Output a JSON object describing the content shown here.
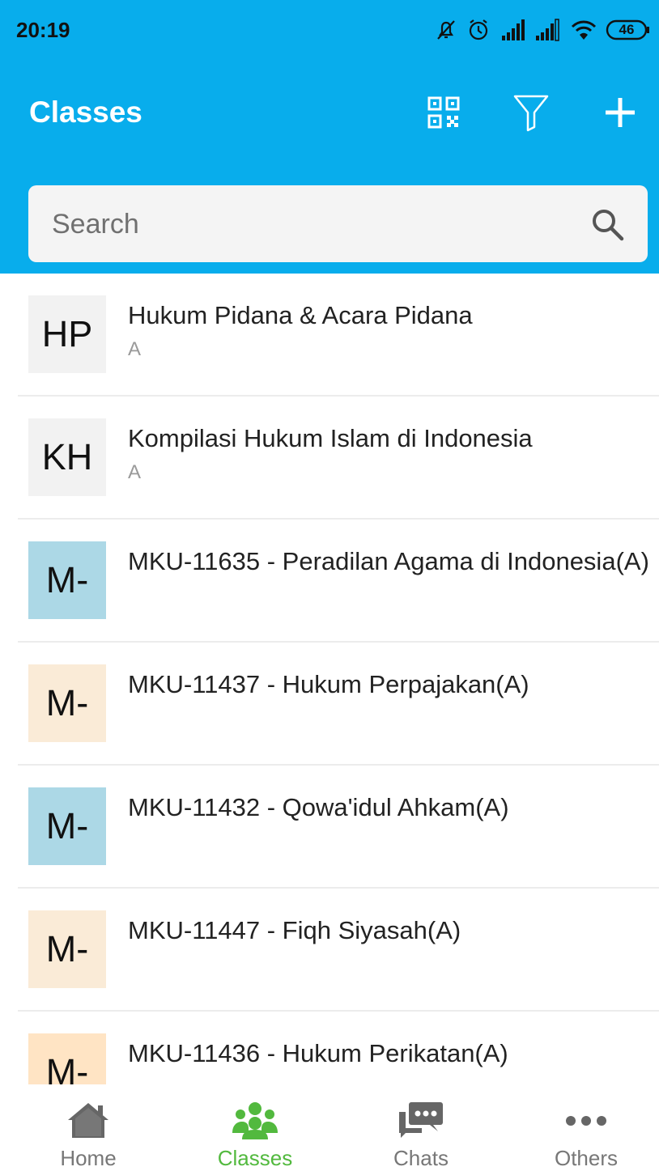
{
  "status_bar": {
    "time": "20:19",
    "battery": "46"
  },
  "header": {
    "title": "Classes"
  },
  "search": {
    "placeholder": "Search"
  },
  "classes": [
    {
      "initials": "HP",
      "title": "Hukum Pidana & Acara Pidana",
      "subtitle": "A",
      "avatar_color": "#f2f2f2"
    },
    {
      "initials": "KH",
      "title": "Kompilasi Hukum Islam di Indonesia",
      "subtitle": "A",
      "avatar_color": "#f2f2f2"
    },
    {
      "initials": "M-",
      "title": "MKU-11635 - Peradilan Agama di Indonesia(A)",
      "subtitle": "",
      "avatar_color": "#acd8e6"
    },
    {
      "initials": "M-",
      "title": "MKU-11437 - Hukum Perpajakan(A)",
      "subtitle": "",
      "avatar_color": "#faebd7"
    },
    {
      "initials": "M-",
      "title": "MKU-11432 - Qowa'idul Ahkam(A)",
      "subtitle": "",
      "avatar_color": "#acd8e6"
    },
    {
      "initials": "M-",
      "title": "MKU-11447 - Fiqh Siyasah(A)",
      "subtitle": "",
      "avatar_color": "#faebd7"
    },
    {
      "initials": "M-",
      "title": "MKU-11436 - Hukum Perikatan(A)",
      "subtitle": "",
      "avatar_color": "#ffe4c4"
    }
  ],
  "tabs": [
    {
      "label": "Home",
      "icon": "home-icon"
    },
    {
      "label": "Classes",
      "icon": "classes-icon",
      "active": true
    },
    {
      "label": "Chats",
      "icon": "chats-icon"
    },
    {
      "label": "Others",
      "icon": "more-icon"
    }
  ],
  "colors": {
    "header": "#08adec",
    "active_tab": "#52b93e",
    "inactive_tab": "#777777"
  }
}
